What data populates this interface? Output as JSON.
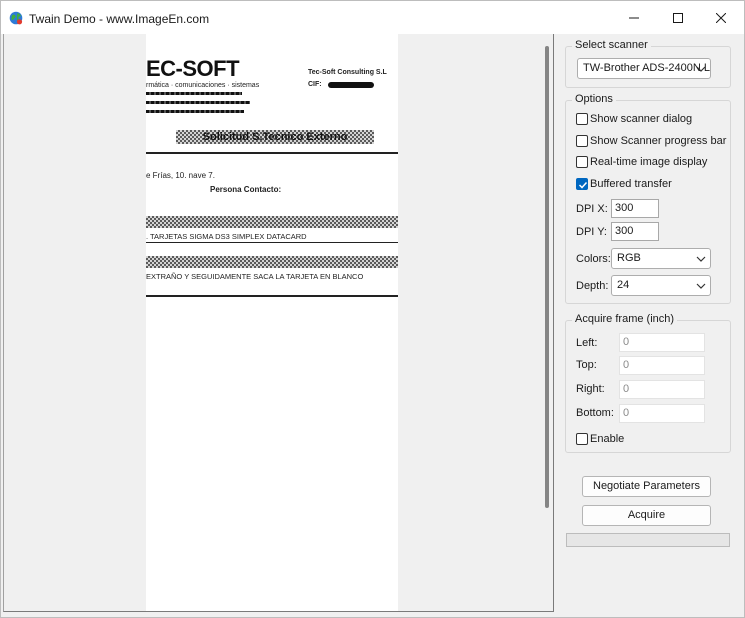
{
  "window": {
    "title": "Twain Demo  - www.ImageEn.com"
  },
  "preview": {
    "logo": "EC-SOFT",
    "subtitle": "rmática · comunicaciones · sistemas",
    "company": "Tec-Soft Consulting S.L",
    "cif_label": "CIF:",
    "heading": "Solicitud S.Tecnico Externo",
    "date_line": "e Frías, 10. nave 7.",
    "contact_label": "Persona Contacto:",
    "line1": ". TARJETAS SIGMA DS3 SIMPLEX DATACARD",
    "line2": "EXTRAÑO Y SEGUIDAMENTE SACA LA TARJETA EN BLANCO"
  },
  "scanner": {
    "group_title": "Select scanner",
    "selected": "TW-Brother ADS-2400N L"
  },
  "options": {
    "group_title": "Options",
    "show_scanner_dialog": {
      "label": "Show scanner dialog",
      "checked": false
    },
    "show_progress_bar": {
      "label": "Show Scanner progress bar",
      "checked": false
    },
    "realtime_display": {
      "label": "Real-time image display",
      "checked": false
    },
    "buffered_transfer": {
      "label": "Buffered transfer",
      "checked": true
    },
    "dpi_x_label": "DPI X:",
    "dpi_x_value": "300",
    "dpi_y_label": "DPI Y:",
    "dpi_y_value": "300",
    "colors_label": "Colors:",
    "colors_value": "RGB",
    "depth_label": "Depth:",
    "depth_value": "24"
  },
  "frame": {
    "group_title": "Acquire frame (inch)",
    "left_label": "Left:",
    "left_value": "0",
    "top_label": "Top:",
    "top_value": "0",
    "right_label": "Right:",
    "right_value": "0",
    "bottom_label": "Bottom:",
    "bottom_value": "0",
    "enable": {
      "label": "Enable",
      "checked": false
    }
  },
  "actions": {
    "negotiate_label": "Negotiate Parameters",
    "acquire_label": "Acquire"
  },
  "progress": {
    "value": 0
  },
  "colors": {
    "accent": "#0067c0",
    "progress": "#06b025"
  },
  "icons": {
    "app": "globe-icon",
    "minimize": "minimize-icon",
    "maximize": "maximize-icon",
    "close": "close-icon",
    "dropdown": "chevron-down-icon",
    "check": "checkmark-icon"
  }
}
